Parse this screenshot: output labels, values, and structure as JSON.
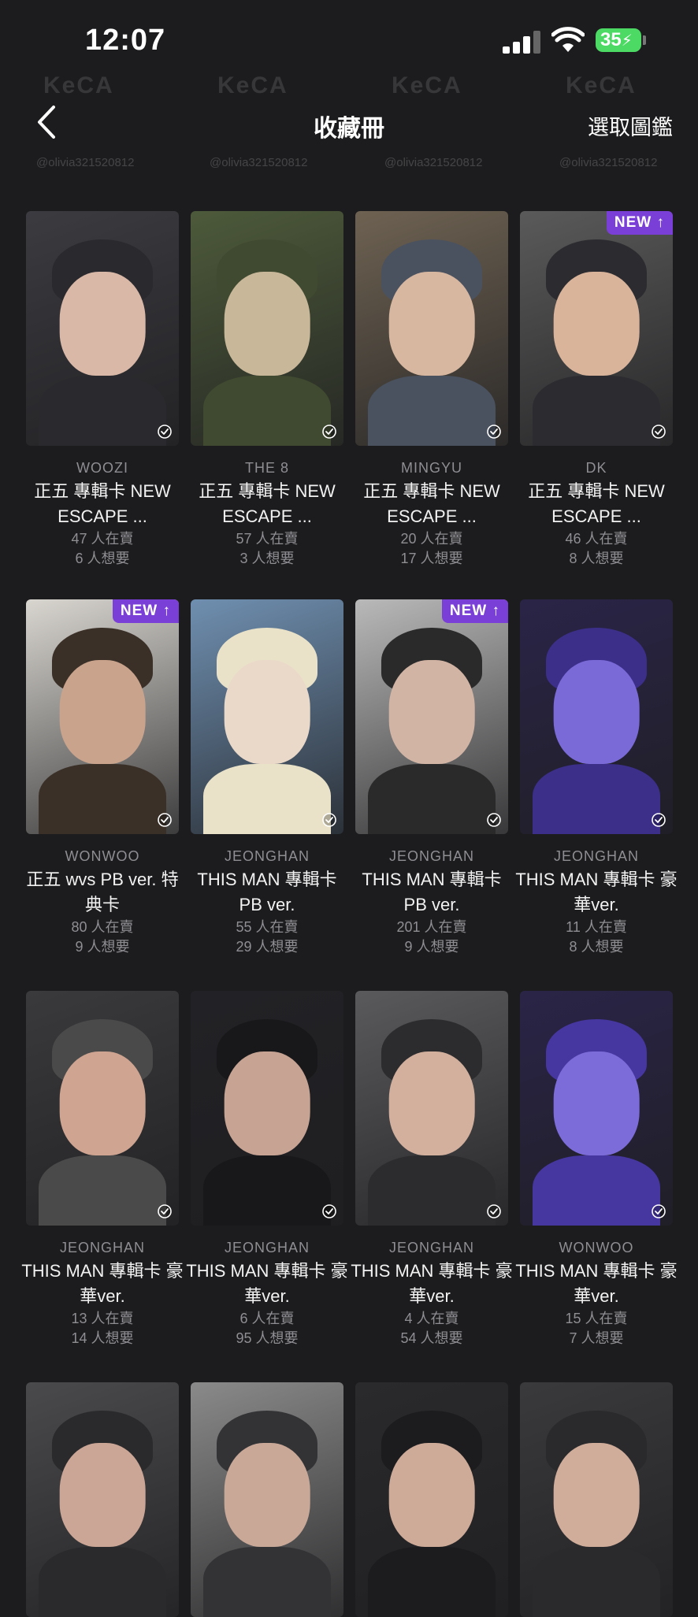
{
  "status_bar": {
    "time": "12:07",
    "battery": "35"
  },
  "header": {
    "title": "收藏冊",
    "action": "選取圖鑑"
  },
  "watermark": {
    "logo": "KeCA",
    "handle": "@olivia321520812"
  },
  "cards": [
    {
      "member": "WOOZI",
      "name": "正五 專輯卡 NEW ESCAPE ...",
      "sellers": "47 人在賣",
      "wants": "6 人想要",
      "new": false,
      "tone": [
        "#3b3b40",
        "#d9b8a8",
        "#2a2a2e"
      ]
    },
    {
      "member": "THE 8",
      "name": "正五 專輯卡 NEW ESCAPE ...",
      "sellers": "57 人在賣",
      "wants": "3 人想要",
      "new": false,
      "tone": [
        "#4d5a3a",
        "#c9b79a",
        "#404a30"
      ]
    },
    {
      "member": "MINGYU",
      "name": "正五 專輯卡 NEW ESCAPE ...",
      "sellers": "20 人在賣",
      "wants": "17 人想要",
      "new": false,
      "tone": [
        "#6e6252",
        "#d8b7a0",
        "#4a5260"
      ]
    },
    {
      "member": "DK",
      "name": "正五 專輯卡 NEW ESCAPE ...",
      "sellers": "46 人在賣",
      "wants": "8 人想要",
      "new": true,
      "tone": [
        "#5a5a5a",
        "#d9b39a",
        "#2c2c30"
      ]
    },
    {
      "member": "WONWOO",
      "name": "正五 wvs PB ver. 特典卡",
      "sellers": "80 人在賣",
      "wants": "9 人想要",
      "new": true,
      "tone": [
        "#d9d6d0",
        "#c9a38c",
        "#3a3028"
      ]
    },
    {
      "member": "JEONGHAN",
      "name": "THIS MAN 專輯卡 PB ver.",
      "sellers": "55 人在賣",
      "wants": "29 人想要",
      "new": false,
      "tone": [
        "#6f8fb0",
        "#ead9c8",
        "#e9e2c8"
      ]
    },
    {
      "member": "JEONGHAN",
      "name": "THIS MAN 專輯卡 PB ver.",
      "sellers": "201 人在賣",
      "wants": "9 人想要",
      "new": true,
      "tone": [
        "#b9b9b9",
        "#d2b4a4",
        "#2a2a2a"
      ]
    },
    {
      "member": "JEONGHAN",
      "name": "THIS MAN 專輯卡 豪華ver.",
      "sellers": "11 人在賣",
      "wants": "8 人想要",
      "new": false,
      "tone": [
        "#2a2447",
        "#7a6ad8",
        "#3b2f8a"
      ]
    },
    {
      "member": "JEONGHAN",
      "name": "THIS MAN 專輯卡 豪華ver.",
      "sellers": "13 人在賣",
      "wants": "14 人想要",
      "new": false,
      "tone": [
        "#3a3a3c",
        "#cfa592",
        "#4a4a4a"
      ]
    },
    {
      "member": "JEONGHAN",
      "name": "THIS MAN 專輯卡 豪華ver.",
      "sellers": "6 人在賣",
      "wants": "95 人想要",
      "new": false,
      "tone": [
        "#222226",
        "#c7a393",
        "#18181a"
      ]
    },
    {
      "member": "JEONGHAN",
      "name": "THIS MAN 專輯卡 豪華ver.",
      "sellers": "4 人在賣",
      "wants": "54 人想要",
      "new": false,
      "tone": [
        "#5a5a5c",
        "#d3b09e",
        "#2c2c2e"
      ]
    },
    {
      "member": "WONWOO",
      "name": "THIS MAN 專輯卡 豪華ver.",
      "sellers": "15 人在賣",
      "wants": "7 人想要",
      "new": false,
      "tone": [
        "#2a2447",
        "#7c6cda",
        "#4636a0"
      ]
    },
    {
      "member": "",
      "name": "",
      "sellers": "",
      "wants": "",
      "new": false,
      "tone": [
        "#4a4a4c",
        "#cba595",
        "#2a2a2c"
      ]
    },
    {
      "member": "",
      "name": "",
      "sellers": "",
      "wants": "",
      "new": false,
      "tone": [
        "#8a8a8a",
        "#c9a898",
        "#333336"
      ]
    },
    {
      "member": "",
      "name": "",
      "sellers": "",
      "wants": "",
      "new": false,
      "tone": [
        "#2a2a2c",
        "#ceaa98",
        "#1c1c1e"
      ]
    },
    {
      "member": "",
      "name": "",
      "sellers": "",
      "wants": "",
      "new": false,
      "tone": [
        "#3a3a3c",
        "#d0ac9a",
        "#2a2a2c"
      ]
    }
  ],
  "badge_label": "NEW"
}
